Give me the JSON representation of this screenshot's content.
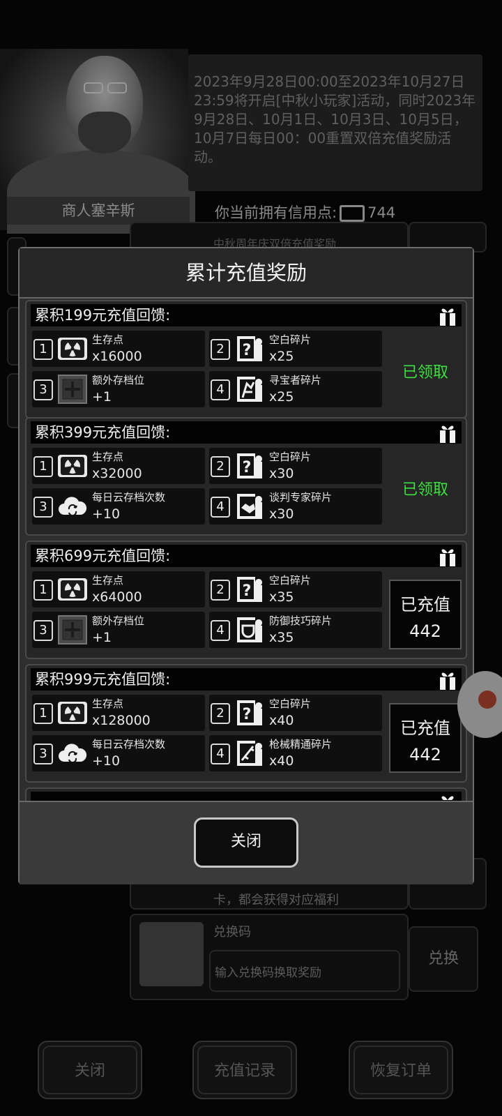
{
  "background": {
    "merchant_name": "商人塞辛斯",
    "announcement": "2023年9月28日00:00至2023年10月27日23:59将开启[中秋小玩家]活动，同时2023年9月28日、10月1日、10月3日、10月5日，10月7日每日00：00重置双倍充值奖励活动。",
    "credits_label": "你当前拥有信用点:",
    "credits_value": "744",
    "event_title": "中秋周年庆双倍充值奖励",
    "partial_text": "卡，都会获得对应福利",
    "redeem": {
      "title": "兑换码",
      "placeholder": "输入兑换码换取奖励",
      "button": "兑换"
    },
    "bottom_buttons": [
      "关闭",
      "充值记录",
      "恢复订单"
    ]
  },
  "modal": {
    "title": "累计充值奖励",
    "close_label": "关闭",
    "tiers": [
      {
        "title": "累积199元充值回馈:",
        "status": "已领取",
        "rewards": [
          {
            "num": "1",
            "icon": "radiation-icon",
            "name": "生存点",
            "qty": "x16000"
          },
          {
            "num": "2",
            "icon": "blank-fragment-icon",
            "name": "空白碎片",
            "qty": "x25"
          },
          {
            "num": "3",
            "icon": "extra-slot-icon",
            "name": "额外存档位",
            "qty": "+1"
          },
          {
            "num": "4",
            "icon": "treasure-hunter-fragment-icon",
            "name": "寻宝者碎片",
            "qty": "x25"
          }
        ]
      },
      {
        "title": "累积399元充值回馈:",
        "status": "已领取",
        "rewards": [
          {
            "num": "1",
            "icon": "radiation-icon",
            "name": "生存点",
            "qty": "x32000"
          },
          {
            "num": "2",
            "icon": "blank-fragment-icon",
            "name": "空白碎片",
            "qty": "x30"
          },
          {
            "num": "3",
            "icon": "cloud-save-icon",
            "name": "每日云存档次数",
            "qty": "+10"
          },
          {
            "num": "4",
            "icon": "negotiator-fragment-icon",
            "name": "谈判专家碎片",
            "qty": "x30"
          }
        ]
      },
      {
        "title": "累积699元充值回馈:",
        "status_label": "已充值",
        "status_value": "442",
        "rewards": [
          {
            "num": "1",
            "icon": "radiation-icon",
            "name": "生存点",
            "qty": "x64000"
          },
          {
            "num": "2",
            "icon": "blank-fragment-icon",
            "name": "空白碎片",
            "qty": "x35"
          },
          {
            "num": "3",
            "icon": "extra-slot-icon",
            "name": "额外存档位",
            "qty": "+1"
          },
          {
            "num": "4",
            "icon": "defense-skill-fragment-icon",
            "name": "防御技巧碎片",
            "qty": "x35"
          }
        ]
      },
      {
        "title": "累积999元充值回馈:",
        "status_label": "已充值",
        "status_value": "442",
        "rewards": [
          {
            "num": "1",
            "icon": "radiation-icon",
            "name": "生存点",
            "qty": "x128000"
          },
          {
            "num": "2",
            "icon": "blank-fragment-icon",
            "name": "空白碎片",
            "qty": "x40"
          },
          {
            "num": "3",
            "icon": "cloud-save-icon",
            "name": "每日云存档次数",
            "qty": "+10"
          },
          {
            "num": "4",
            "icon": "firearm-mastery-fragment-icon",
            "name": "枪械精通碎片",
            "qty": "x40"
          }
        ]
      }
    ]
  },
  "colors": {
    "claimed": "#3de03d",
    "modal_bg": "#2e2e2e",
    "header_bg": "#030303"
  }
}
